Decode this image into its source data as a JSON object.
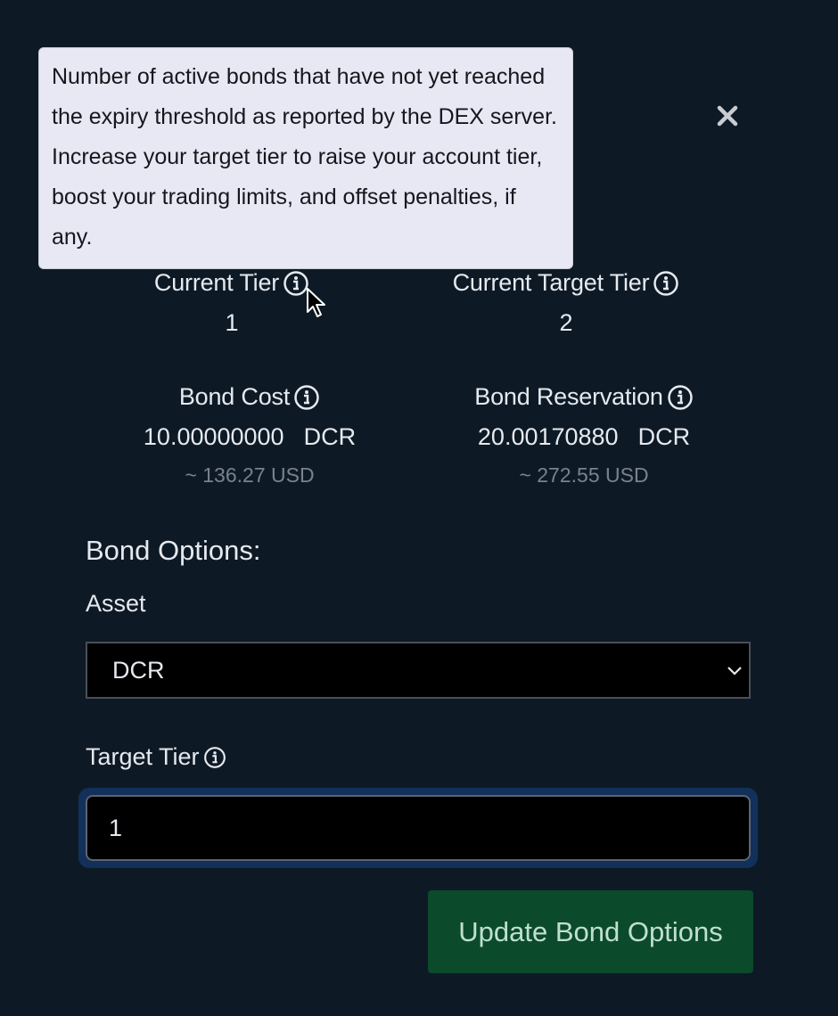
{
  "tooltip": {
    "text": "Number of active bonds that have not yet reached the expiry threshold as reported by the DEX server. Increase your target tier to raise your account tier, boost your trading limits, and offset penalties, if any."
  },
  "close_button": {
    "icon": "close-icon",
    "glyph": "×"
  },
  "stats": {
    "current_tier": {
      "label": "Current Tier",
      "value": "1",
      "icon": "info-icon"
    },
    "current_target_tier": {
      "label": "Current Target Tier",
      "value": "2",
      "icon": "info-icon"
    },
    "bond_cost": {
      "label": "Bond Cost",
      "amount": "10.00000000",
      "unit": "DCR",
      "fiat": "~ 136.27 USD",
      "icon": "info-icon"
    },
    "bond_reservation": {
      "label": "Bond Reservation",
      "amount": "20.00170880",
      "unit": "DCR",
      "fiat": "~ 272.55 USD",
      "icon": "info-icon"
    }
  },
  "bond_options": {
    "title": "Bond Options:",
    "asset": {
      "label": "Asset",
      "selected": "DCR",
      "icon": "chevron-down-icon"
    },
    "target_tier": {
      "label": "Target Tier",
      "value": "1",
      "icon": "info-icon"
    },
    "submit_label": "Update Bond Options"
  },
  "colors": {
    "background": "#0d1a26",
    "tooltip_bg": "#e8e7f4",
    "button_bg": "#0c4a2c",
    "button_text": "#bfe0cd",
    "focus_ring": "#12305a",
    "muted_text": "#7a828b"
  }
}
